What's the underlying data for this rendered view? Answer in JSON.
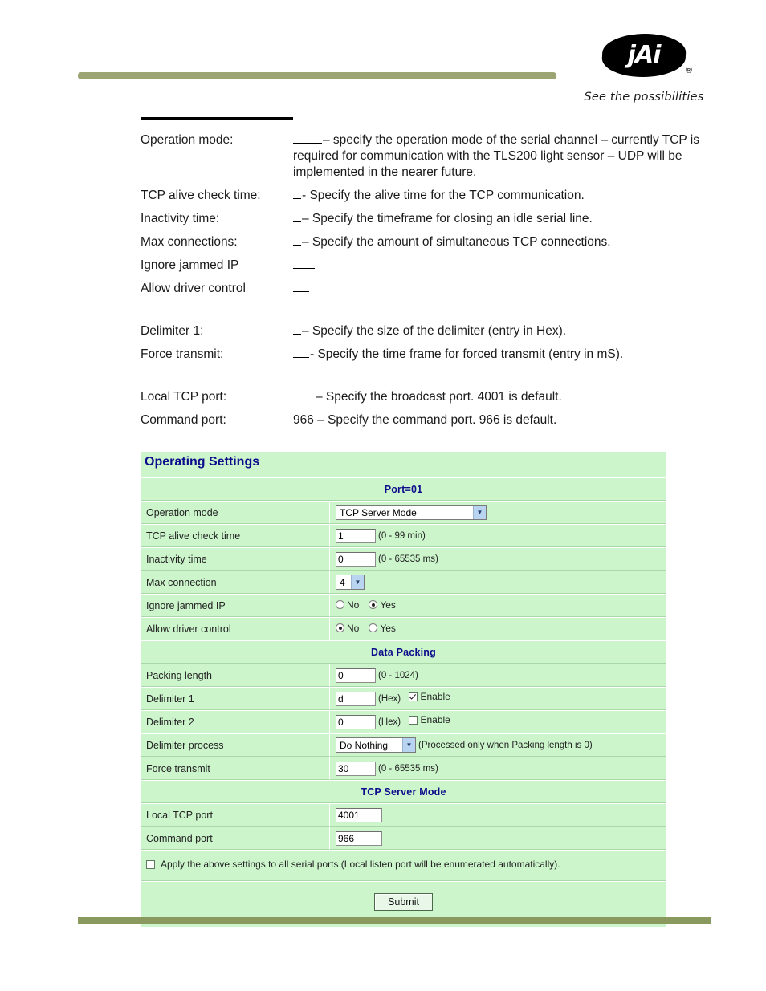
{
  "header": {
    "logo_text": "jAi",
    "logo_registered": "®",
    "tagline": "See the possibilities"
  },
  "description": {
    "rows": [
      {
        "label": "Operation mode:",
        "blank": "w4",
        "text": "– specify the operation mode of the serial channel – currently TCP is required for communication with the TLS200 light sensor – UDP will be implemented in the nearer future."
      },
      {
        "label": "TCP alive check time:",
        "blank": "w1",
        "text": "- Specify the alive time for the TCP communication."
      },
      {
        "label": "Inactivity time:",
        "blank": "w1",
        "text": "– Specify the timeframe for closing an idle serial line."
      },
      {
        "label": "Max connections:",
        "blank": "w1",
        "text": "– Specify the amount of simultaneous TCP connections."
      },
      {
        "label": "Ignore jammed IP",
        "blank": "w3",
        "text": ""
      },
      {
        "label": "Allow driver control",
        "blank": "w2",
        "text": ""
      },
      {
        "label": "Delimiter 1:",
        "blank": "w1",
        "text": "– Specify the size of the delimiter (entry in Hex)."
      },
      {
        "label": "Force transmit:",
        "blank": "w2",
        "text": "- Specify the time frame for forced transmit (entry in mS)."
      },
      {
        "label": "Local TCP port:",
        "blank": "w3",
        "text": "– Specify the broadcast port. 4001 is default."
      },
      {
        "label": "Command port:",
        "blank": "",
        "text": "966 – Specify the command port. 966 is default."
      }
    ]
  },
  "settings_panel": {
    "title": "Operating Settings",
    "section_port": "Port=01",
    "section_data_packing": "Data Packing",
    "section_tcp_server": "TCP Server Mode",
    "rows": {
      "operation_mode": {
        "label": "Operation mode",
        "value": "TCP Server Mode"
      },
      "tcp_alive_check_time": {
        "label": "TCP alive check time",
        "value": "1",
        "hint": "(0 - 99 min)"
      },
      "inactivity_time": {
        "label": "Inactivity time",
        "value": "0",
        "hint": "(0 - 65535 ms)"
      },
      "max_connection": {
        "label": "Max connection",
        "value": "4"
      },
      "ignore_jammed_ip": {
        "label": "Ignore jammed IP",
        "option_no": "No",
        "option_yes": "Yes",
        "selected": "Yes"
      },
      "allow_driver_control": {
        "label": "Allow driver control",
        "option_no": "No",
        "option_yes": "Yes",
        "selected": "No"
      },
      "packing_length": {
        "label": "Packing length",
        "value": "0",
        "hint": "(0 - 1024)"
      },
      "delimiter_1": {
        "label": "Delimiter 1",
        "value": "d",
        "hex_label": "(Hex)",
        "enable_label": "Enable",
        "enabled": true
      },
      "delimiter_2": {
        "label": "Delimiter 2",
        "value": "0",
        "hex_label": "(Hex)",
        "enable_label": "Enable",
        "enabled": false
      },
      "delimiter_process": {
        "label": "Delimiter process",
        "value": "Do Nothing",
        "hint": "(Processed only when Packing length is 0)"
      },
      "force_transmit": {
        "label": "Force transmit",
        "value": "30",
        "hint": "(0 - 65535 ms)"
      },
      "local_tcp_port": {
        "label": "Local TCP port",
        "value": "4001"
      },
      "command_port": {
        "label": "Command port",
        "value": "966"
      }
    },
    "apply_all": {
      "label": "Apply the above settings to all serial ports (Local listen port will be enumerated automatically).",
      "checked": false
    },
    "submit_label": "Submit"
  },
  "colors": {
    "panel_bg": "#ccf5cc",
    "panel_title": "#0d0d8c",
    "header_bar": "#9ba472",
    "footer_bar": "#8a9a5e"
  }
}
